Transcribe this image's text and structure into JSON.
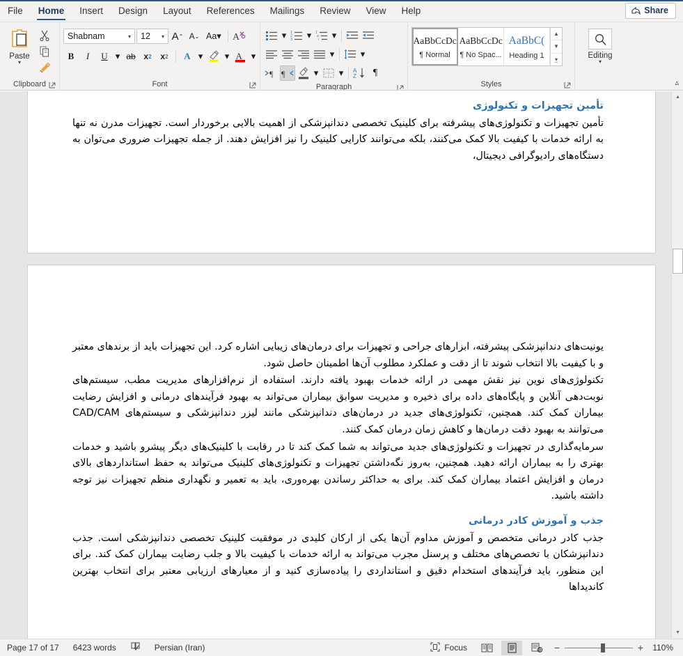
{
  "tabs": [
    {
      "label": "File",
      "active": false
    },
    {
      "label": "Home",
      "active": true
    },
    {
      "label": "Insert",
      "active": false
    },
    {
      "label": "Design",
      "active": false
    },
    {
      "label": "Layout",
      "active": false
    },
    {
      "label": "References",
      "active": false
    },
    {
      "label": "Mailings",
      "active": false
    },
    {
      "label": "Review",
      "active": false
    },
    {
      "label": "View",
      "active": false
    },
    {
      "label": "Help",
      "active": false
    }
  ],
  "share": {
    "label": "Share"
  },
  "ribbon": {
    "clipboard": {
      "label": "Clipboard",
      "paste_label": "Paste",
      "cut_name": "cut",
      "copy_name": "copy",
      "format_painter_name": "format-painter"
    },
    "font": {
      "label": "Font",
      "font_name": "Shabnam",
      "font_size": "12",
      "grow_label": "A",
      "shrink_label": "A",
      "change_case_label": "Aa",
      "clear_format_label": "A",
      "bold_label": "B",
      "italic_label": "I",
      "underline_label": "U",
      "strikethrough_label": "ab",
      "subscript_label": "x",
      "superscript_label": "x",
      "text_effects_label": "A",
      "highlight_label": "A",
      "font_color_label": "A"
    },
    "paragraph": {
      "label": "Paragraph",
      "bullets": "bullets",
      "numbering": "numbering",
      "multilevel": "multilevel-list",
      "decrease_indent": "decrease-indent",
      "increase_indent": "increase-indent",
      "align_left": "align-left",
      "align_center": "align-center",
      "align_right": "align-right",
      "justify": "justify",
      "line_spacing": "line-spacing",
      "ltr": "left-to-right",
      "rtl": "right-to-left",
      "shading": "shading",
      "borders": "borders",
      "sort": "sort",
      "show_marks": "show-formatting-marks"
    },
    "styles": {
      "label": "Styles",
      "items": [
        {
          "preview": "AaBbCcDc",
          "name": "¶ Normal",
          "active": true
        },
        {
          "preview": "AaBbCcDc",
          "name": "¶ No Spac...",
          "active": false
        },
        {
          "preview": "AaBbC(",
          "name": "Heading 1",
          "active": false
        }
      ]
    },
    "editing": {
      "label": "Editing",
      "icon": "search-icon"
    }
  },
  "document": {
    "page1": {
      "heading": "تأمین تجهیزات و تکنولوژی",
      "paragraph": "تأمین تجهیزات و تکنولوژی‌های پیشرفته برای کلینیک تخصصی دندانپزشکی از اهمیت بالایی برخوردار است. تجهیزات مدرن نه تنها به ارائه خدمات با کیفیت بالا کمک می‌کنند، بلکه می‌توانند کارایی کلینیک را نیز افزایش دهند. از جمله تجهیزات ضروری می‌توان به دستگاه‌های رادیوگرافی دیجیتال،"
    },
    "page2": {
      "para1": "یونیت‌های دندانپزشکی پیشرفته، ابزارهای جراحی و تجهیزات برای درمان‌های زیبایی اشاره کرد. این تجهیزات باید از برندهای معتبر و با کیفیت بالا انتخاب شوند تا از دقت و عملکرد مطلوب آن‌ها اطمینان حاصل شود.",
      "para2": "تکنولوژی‌های نوین نیز نقش مهمی در ارائه خدمات بهبود یافته دارند. استفاده از نرم‌افزارهای مدیریت مطب، سیستم‌های نوبت‌دهی آنلاین و پایگاه‌های داده برای ذخیره و مدیریت سوابق بیماران می‌تواند به بهبود فرآیندهای درمانی و افزایش رضایت بیماران کمک کند. همچنین، تکنولوژی‌های جدید در درمان‌های دندانپزشکی مانند لیزر دندانپزشکی و سیستم‌های CAD/CAM می‌توانند به بهبود دقت درمان‌ها و کاهش زمان درمان کمک کنند.",
      "para3": "سرمایه‌گذاری در تجهیزات و تکنولوژی‌های جدید می‌تواند به شما کمک کند تا در رقابت با کلینیک‌های دیگر پیشرو باشید و خدمات بهتری را به بیماران ارائه دهید. همچنین، به‌روز نگه‌داشتن تجهیزات و تکنولوژی‌های کلینیک می‌تواند به حفظ استانداردهای بالای درمان و افزایش اعتماد بیماران کمک کند. برای به حداکثر رساندن بهره‌وری، باید به تعمیر و نگهداری منظم تجهیزات نیز توجه داشته باشید.",
      "heading": "جذب و آموزش کادر درمانی",
      "para4": "جذب کادر درمانی متخصص و آموزش مداوم آن‌ها یکی از ارکان کلیدی در موفقیت کلینیک تخصصی دندانپزشکی است. جذب دندانپزشکان با تخصص‌های مختلف و پرسنل مجرب می‌تواند به ارائه خدمات با کیفیت بالا و جلب رضایت بیماران کمک کند. برای این منظور، باید فرآیندهای استخدام دقیق و استانداردی را پیاده‌سازی کنید و از معیارهای ارزیابی معتبر برای انتخاب بهترین کاندیداها"
    }
  },
  "statusbar": {
    "page": "Page 17 of 17",
    "words": "6423 words",
    "proofing_icon": "proofing-icon",
    "language": "Persian (Iran)",
    "focus": "Focus",
    "read_mode": "read-mode-icon",
    "print_layout": "print-layout-icon",
    "web_layout": "web-layout-icon",
    "zoom_out": "−",
    "zoom_in": "+",
    "zoom_level": "110%"
  },
  "colors": {
    "accent": "#2b579a",
    "heading": "#2e74b5",
    "ribbon_bg": "#f3f2f1",
    "doc_bg": "#e7e6e6"
  }
}
